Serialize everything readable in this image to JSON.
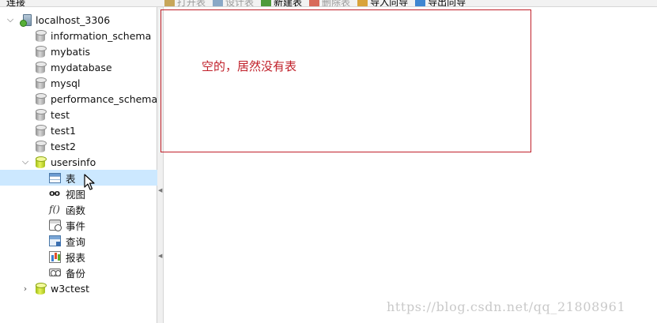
{
  "header": {
    "connection_label": "连接"
  },
  "toolbar": {
    "buttons": [
      {
        "label": "打开表",
        "color": "#c7a65a",
        "enabled": false
      },
      {
        "label": "设计表",
        "color": "#8aa8c6",
        "enabled": false
      },
      {
        "label": "新建表",
        "color": "#4f9a3a",
        "enabled": true
      },
      {
        "label": "删除表",
        "color": "#d86a5a",
        "enabled": false
      },
      {
        "label": "导入向导",
        "color": "#d9a33a",
        "enabled": true
      },
      {
        "label": "导出向导",
        "color": "#3f86d1",
        "enabled": true
      }
    ]
  },
  "navigator": {
    "connection": {
      "label": "localhost_3306",
      "icon": "server-icon",
      "expanded": true
    },
    "databases": [
      {
        "label": "information_schema",
        "icon": "database-icon",
        "active": false
      },
      {
        "label": "mybatis",
        "icon": "database-icon",
        "active": false
      },
      {
        "label": "mydatabase",
        "icon": "database-icon",
        "active": false
      },
      {
        "label": "mysql",
        "icon": "database-icon",
        "active": false
      },
      {
        "label": "performance_schema",
        "icon": "database-icon",
        "active": false
      },
      {
        "label": "test",
        "icon": "database-icon",
        "active": false
      },
      {
        "label": "test1",
        "icon": "database-icon",
        "active": false
      },
      {
        "label": "test2",
        "icon": "database-icon",
        "active": false
      },
      {
        "label": "usersinfo",
        "icon": "database-icon",
        "active": true,
        "expanded": true
      },
      {
        "label": "w3ctest",
        "icon": "database-icon",
        "active": true,
        "expanded": false
      }
    ],
    "objects": [
      {
        "label": "表",
        "icon": "table-icon",
        "selected": true
      },
      {
        "label": "视图",
        "icon": "view-icon",
        "selected": false
      },
      {
        "label": "函数",
        "icon": "function-icon",
        "selected": false
      },
      {
        "label": "事件",
        "icon": "event-icon",
        "selected": false
      },
      {
        "label": "查询",
        "icon": "query-icon",
        "selected": false
      },
      {
        "label": "报表",
        "icon": "report-icon",
        "selected": false
      },
      {
        "label": "备份",
        "icon": "backup-icon",
        "selected": false
      }
    ]
  },
  "content": {
    "annotation": "空的，居然没有表",
    "annotation_color": "#c0202a",
    "watermark": "https://blog.csdn.net/qq_21808961"
  }
}
